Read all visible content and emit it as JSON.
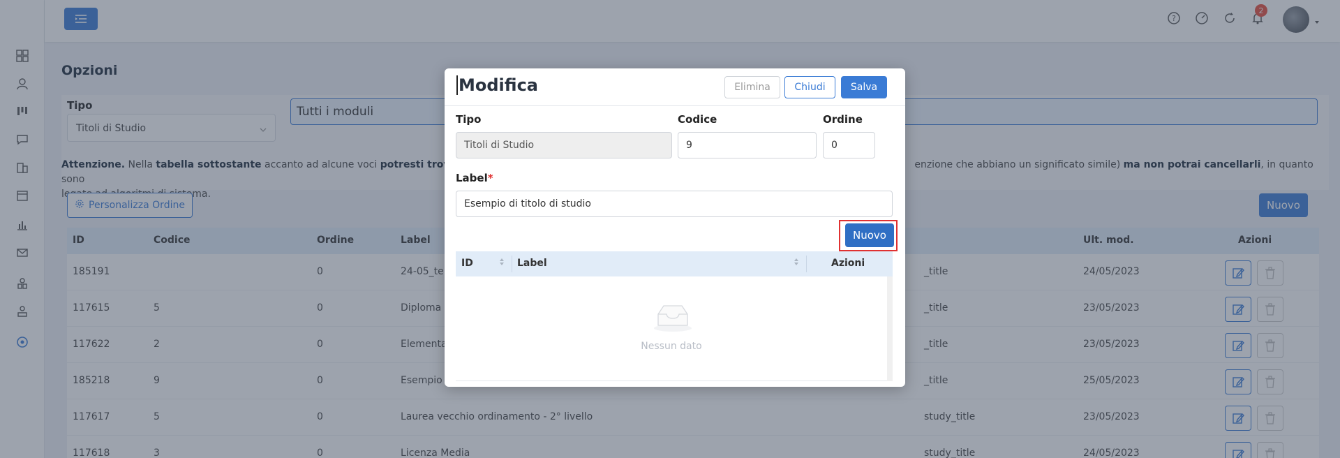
{
  "topbar": {
    "notification_count": "2"
  },
  "page": {
    "title": "Opzioni",
    "filter_label": "Tipo",
    "filter_value": "Titoli di Studio",
    "module_input": "Tutti i moduli",
    "warning": {
      "part1": "Attenzione.",
      "part2": " Nella ",
      "part3": "tabella sottostante",
      "part4": " accanto ad alcune voci ",
      "part5": "potresti trovare",
      "part6": "enzione che abbiano un significato simile) ",
      "part7": "ma non potrai cancellarli",
      "part8": ", in quanto sono",
      "line2": "legate ad algoritmi di sistema."
    },
    "personalize_button": "Personalizza Ordine",
    "new_button": "Nuovo"
  },
  "table": {
    "headers": {
      "id": "ID",
      "codice": "Codice",
      "ordine": "Ordine",
      "label": "Label",
      "ult_mod": "Ult. mod.",
      "azioni": "Azioni"
    },
    "rows": [
      {
        "id": "185191",
        "codice": "",
        "ordine": "0",
        "label": "24-05_te",
        "type": "_title",
        "date": "24/05/2023"
      },
      {
        "id": "117615",
        "codice": "5",
        "ordine": "0",
        "label": "Diploma",
        "type": "_title",
        "date": "23/05/2023"
      },
      {
        "id": "117622",
        "codice": "2",
        "ordine": "0",
        "label": "Elementa",
        "type": "_title",
        "date": "23/05/2023"
      },
      {
        "id": "185218",
        "codice": "9",
        "ordine": "0",
        "label": "Esempio",
        "type": "_title",
        "date": "25/05/2023"
      },
      {
        "id": "117617",
        "codice": "5",
        "ordine": "0",
        "label": "Laurea vecchio ordinamento - 2° livello",
        "type": "study_title",
        "date": "23/05/2023"
      },
      {
        "id": "117618",
        "codice": "3",
        "ordine": "0",
        "label": "Licenza Media",
        "type": "study_title",
        "date": "24/05/2023"
      }
    ]
  },
  "modal": {
    "title": "Modifica",
    "delete_button": "Elimina",
    "close_button": "Chiudi",
    "save_button": "Salva",
    "tipo_label": "Tipo",
    "tipo_value": "Titoli di Studio",
    "codice_label": "Codice",
    "codice_value": "9",
    "ordine_label": "Ordine",
    "ordine_value": "0",
    "label_label": "Label",
    "label_required": "*",
    "label_value": "Esempio di titolo di studio",
    "new_button": "Nuovo",
    "inner_table": {
      "headers": {
        "id": "ID",
        "label": "Label",
        "azioni": "Azioni"
      },
      "empty_text": "Nessun dato"
    }
  },
  "colors": {
    "primary": "#3a7bd5",
    "danger": "#e03131",
    "header_bg": "#e1ecf8"
  }
}
